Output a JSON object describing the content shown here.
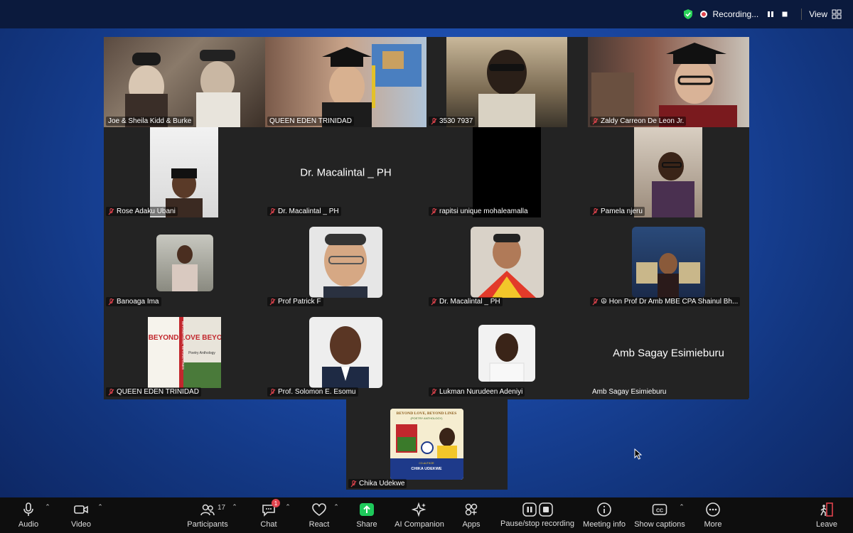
{
  "topbar": {
    "recording_label": "Recording...",
    "view_label": "View",
    "colors": {
      "shield": "#2bd45a",
      "record": "#e0434d"
    }
  },
  "participants": [
    {
      "name": "Joe & Sheila Kidd & Burke",
      "muted": false,
      "active_speaker": true
    },
    {
      "name": "QUEEN EDEN TRINIDAD",
      "muted": false
    },
    {
      "name": "3530 7937",
      "muted": true
    },
    {
      "name": "Zaldy Carreon De Leon Jr.",
      "muted": true
    },
    {
      "name": "Rose Adaku Ubani",
      "muted": true
    },
    {
      "name": "Dr. Macalintal _ PH",
      "muted": true,
      "video_off_label": "Dr. Macalintal _ PH"
    },
    {
      "name": "rapitsi unique mohaleamalla",
      "muted": true
    },
    {
      "name": "Pamela njeru",
      "muted": true
    },
    {
      "name": "Banoaga Ima",
      "muted": true
    },
    {
      "name": "Prof Patrick F",
      "muted": true
    },
    {
      "name": "Dr. Macalintal _ PH",
      "muted": true
    },
    {
      "name": "☮ Hon Prof Dr Amb MBE CPA Shainul Bh...",
      "muted": true
    },
    {
      "name": "QUEEN EDEN TRINIDAD",
      "muted": true
    },
    {
      "name": "Prof. Solomon E. Esomu",
      "muted": true
    },
    {
      "name": "Lukman Nurudeen Adeniyi",
      "muted": true
    },
    {
      "name": "Amb Sagay Esimieburu",
      "muted": false,
      "video_off_label": "Amb Sagay Esimieburu"
    },
    {
      "name": "Chika Udekwe",
      "muted": true
    }
  ],
  "book_cover_text": {
    "spine": "BEYOND LOVE, BEYOND LINES",
    "front_big": "BEYOND LOVE BEYOND LINES",
    "front_sub": "Poetry Anthology",
    "flyer_title": "BEYOND LOVE, BEYOND LINES",
    "flyer_sub": "(POETRY ANTHOLOGY)",
    "flyer_coauthor": "CO-AUTHOR",
    "flyer_name": "CHIKA UDEKWE"
  },
  "toolbar": {
    "audio": "Audio",
    "video": "Video",
    "participants": "Participants",
    "participants_count": "17",
    "chat": "Chat",
    "chat_badge": "1",
    "react": "React",
    "share": "Share",
    "ai_companion": "AI Companion",
    "apps": "Apps",
    "pause_stop_recording": "Pause/stop recording",
    "meeting_info": "Meeting info",
    "show_captions": "Show captions",
    "more": "More",
    "leave": "Leave",
    "colors": {
      "share": "#1ec95b",
      "leave": "#e0434d",
      "badge": "#e0434d"
    }
  }
}
